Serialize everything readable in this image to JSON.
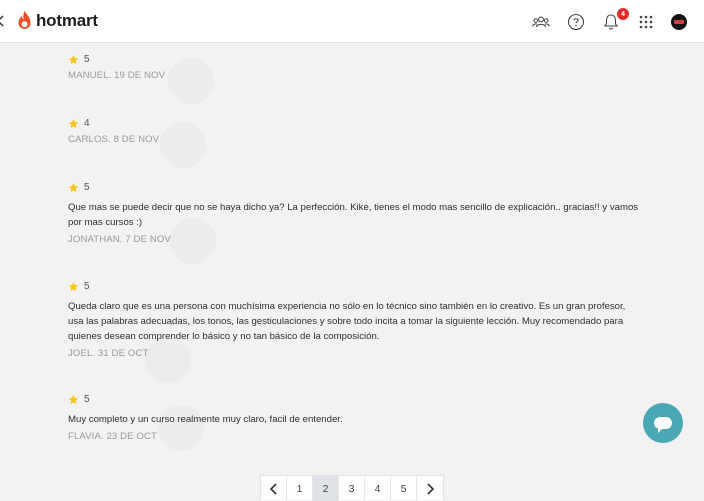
{
  "header": {
    "brand": "hotmart",
    "notification_count": "4",
    "icons": [
      "community-icon",
      "help-icon",
      "bell-icon",
      "apps-grid-icon"
    ]
  },
  "colors": {
    "brand": "#f04e23",
    "star": "#f5c518",
    "chat_button": "#4aa8b5",
    "badge": "#e22d2d"
  },
  "reviews": [
    {
      "rating": "5",
      "comment": "",
      "meta": "MANUEL. 19 DE NOV"
    },
    {
      "rating": "4",
      "comment": "",
      "meta": "CARLOS. 8 DE NOV"
    },
    {
      "rating": "5",
      "comment": "Que mas se puede decir que no se haya dicho ya? La perfección. Kike, tienes el modo mas sencillo de explicación.. gracias!! y vamos por mas cursos :)",
      "meta": "JONATHAN. 7 DE NOV"
    },
    {
      "rating": "5",
      "comment": "Queda claro que es una persona con muchísima experiencia no sólo en lo técnico sino también en lo creativo. Es un gran profesor, usa las palabras adecuadas, los tonos, las gesticulaciones y sobre todo incita a tomar la siguiente lección. Muy recomendado para quienes desean comprender lo básico y no tan básico de la composición.",
      "meta": "JOEL. 31 DE OCT"
    },
    {
      "rating": "5",
      "comment": "Muy completo y un curso realmente muy claro, facil de entender.",
      "meta": "FLAVIA. 23 DE OCT"
    }
  ],
  "pagination": {
    "pages": [
      "1",
      "2",
      "3",
      "4",
      "5"
    ],
    "current": "2"
  }
}
